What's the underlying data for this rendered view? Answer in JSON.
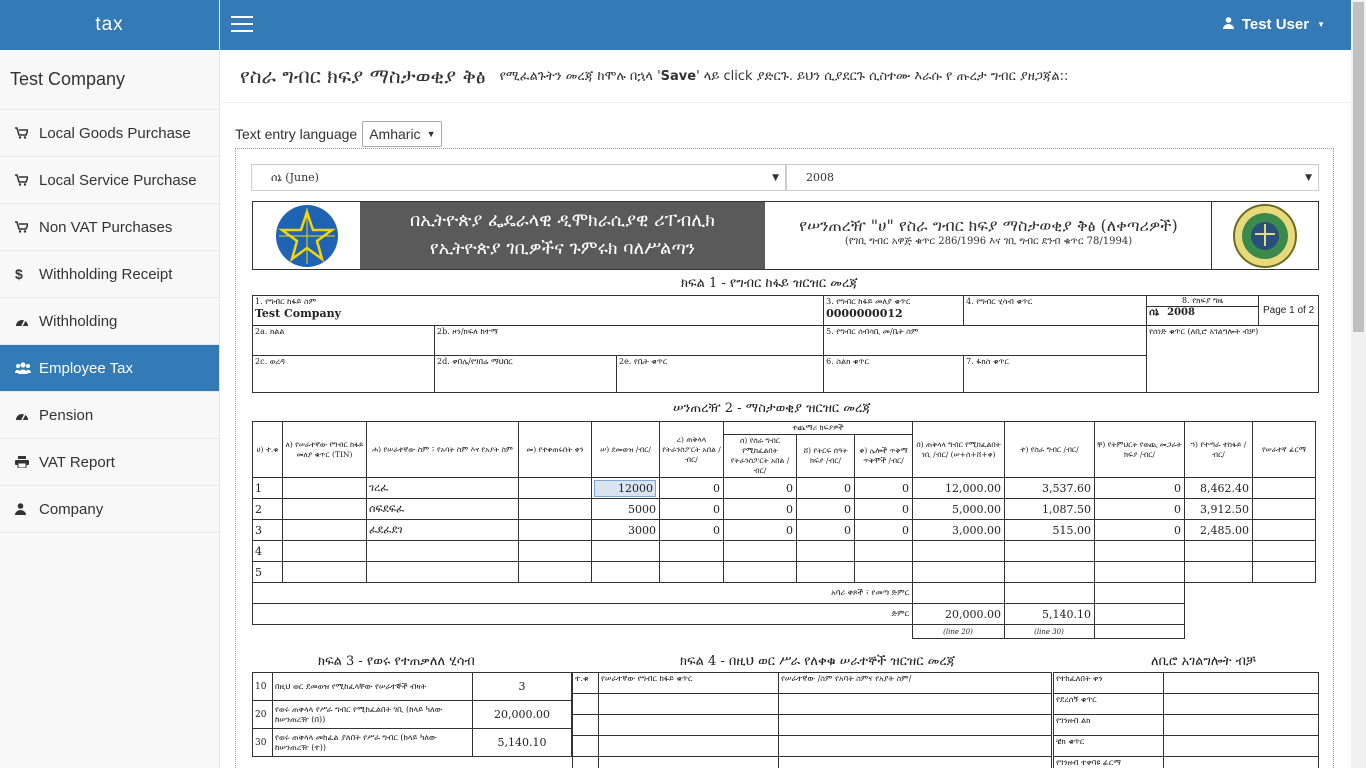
{
  "brand": "tax",
  "company_name": "Test Company",
  "user": {
    "name": "Test User"
  },
  "sidebar": {
    "items": [
      {
        "label": "Local Goods Purchase",
        "icon": "cart-icon"
      },
      {
        "label": "Local Service Purchase",
        "icon": "cart-icon"
      },
      {
        "label": "Non VAT Purchases",
        "icon": "cart-icon"
      },
      {
        "label": "Withholding Receipt",
        "icon": "dollar-icon"
      },
      {
        "label": "Withholding",
        "icon": "dashboard-icon"
      },
      {
        "label": "Employee Tax",
        "icon": "users-icon",
        "active": true
      },
      {
        "label": "Pension",
        "icon": "dashboard-icon"
      },
      {
        "label": "VAT Report",
        "icon": "print-icon"
      },
      {
        "label": "Company",
        "icon": "user-icon"
      }
    ]
  },
  "page": {
    "title": "የስራ ግብር ክፍያ ማስታወቂያ ቅፅ",
    "hint_pre": "የሚፈልጉትን መረጃ ከሞሉ በኋላ '",
    "hint_bold": "Save",
    "hint_post": "' ላይ click ያድርጉ. ይህን ሲያደርጉ ሲስተሙ እራሱ የ ጡረታ ግብር ያዘጋጃል::"
  },
  "language": {
    "label": "Text entry language",
    "selected": "Amharic"
  },
  "period": {
    "month": "ሰኔ (June)",
    "year": "2008"
  },
  "form_header": {
    "agency_line1": "በኢትዮጵያ ፌዴራላዊ ዲሞክራሲያዊ ሪፐብሊክ",
    "agency_line2": "የኢትዮጵያ ገቢዎችና ጉምሩክ ባለሥልጣን",
    "form_title": "የሠንጠረዥ \"ሀ\" የስራ ግብር ክፍያ ማስታወቂያ ቅፅ (ለቀጣሪዎች)",
    "form_subtitle": "(የገቢ ግብር አዋጅ ቁጥር 286/1996 እና ገቢ ግብር ደንብ ቁጥር 78/1994)"
  },
  "section1": {
    "title": "ክፍል 1 - የግብር ከፋይ ዝርዝር መረጃ",
    "f1_label": "1. የግብር ከፋይ ስም",
    "f1_value": "Test Company",
    "f3_label": "3. የግብር ከፋይ መለያ ቁጥር",
    "f3_value": "0000000012",
    "f4_label": "4. የግብር ሂሳብ ቁጥር",
    "f8_label": "8. የክፍያ ግዜ",
    "f8_month": "ሰኔ",
    "f8_year": "2008",
    "page_label": "Page 1 of 2",
    "f2a_label": "2a. ክልል",
    "f2b_label": "2b. ዞን/ክፍለ ከተማ",
    "f5_label": "5. የግብር ሰብሳቢ መ/ቤት ስም",
    "doc_label": "የሰነድ ቁጥር (ለቢሮ አገልግሎት ብቻ)",
    "f2c_label": "2c. ወረዳ",
    "f2d_label": "2d. ቀበሌ/የገበሬ ማህበር",
    "f2e_label": "2e. የቤት ቁጥር",
    "f6_label": "6. ስልክ ቁጥር",
    "f7_label": "7. ፋክስ ቁጥር"
  },
  "section2": {
    "title": "ሠንጠረዥ 2 - ማስታወቂያ ዝርዝር መረጃ",
    "group_header": "ተጨማሪ ክፍያዎች",
    "headers": [
      "ሀ) ተ.ቁ",
      "ለ) የሠራተኛው የግብር ከፋይ መለያ ቁጥር (TIN)",
      "ሐ) የሠራተኛው ስም ፣ የአባት ስም እና የአያት ስም",
      "መ) የተቀጠሩበት ቀን",
      "ሠ) ደመወዝ /ብር/",
      "ረ) ጠቅላላ የትራንስፖርት አበል /ብር/",
      "ሰ) የስራ ግብር የሚከፈልበት የትራንስፖርት አበል /ብር/",
      "ሸ) የትርፍ ሰዓት ክፍያ /ብር/",
      "ቀ) ሌሎች ጥቅማ ጥቅሞች /ብር/",
      "በ) ጠቅላላ ግብር የሚከፈልበት ገቢ /ብር/ (ሠ+ሰ+ሸ+ቀ)",
      "ተ) የስራ ግብር /ብር/",
      "ቸ) የትምህርት የወጪ መጋራት ክፍያ /ብር/",
      "ኀ) የተጣራ ተከፋይ /ብር/",
      "የሠራተኛ ፊርማ"
    ],
    "rows": [
      {
        "no": "1",
        "tin": "",
        "name": "ገረፈ",
        "date": "",
        "salary": "12000",
        "transport": "0",
        "taxable_transport": "0",
        "overtime": "0",
        "other": "0",
        "taxable_income": "12,000.00",
        "tax": "3,537.60",
        "cost_sharing": "0",
        "net": "8,462.40"
      },
      {
        "no": "2",
        "tin": "",
        "name": "ሰፍደፍፈ",
        "date": "",
        "salary": "5000",
        "transport": "0",
        "taxable_transport": "0",
        "overtime": "0",
        "other": "0",
        "taxable_income": "5,000.00",
        "tax": "1,087.50",
        "cost_sharing": "0",
        "net": "3,912.50"
      },
      {
        "no": "3",
        "tin": "",
        "name": "ፈደፈደገ",
        "date": "",
        "salary": "3000",
        "transport": "0",
        "taxable_transport": "0",
        "overtime": "0",
        "other": "0",
        "taxable_income": "3,000.00",
        "tax": "515.00",
        "cost_sharing": "0",
        "net": "2,485.00"
      },
      {
        "no": "4",
        "tin": "",
        "name": "",
        "date": "",
        "salary": "",
        "transport": "",
        "taxable_transport": "",
        "overtime": "",
        "other": "",
        "taxable_income": "",
        "tax": "",
        "cost_sharing": "",
        "net": ""
      },
      {
        "no": "5",
        "tin": "",
        "name": "",
        "date": "",
        "salary": "",
        "transport": "",
        "taxable_transport": "",
        "overtime": "",
        "other": "",
        "taxable_income": "",
        "tax": "",
        "cost_sharing": "",
        "net": ""
      }
    ],
    "page_total_label": "አባሪ ቅጾች ፣ የመጣ ድምር",
    "total_label": "ድምር",
    "total_income": "20,000.00",
    "total_tax": "5,140.10",
    "line20": "(line 20)",
    "line30": "(line 30)"
  },
  "section3": {
    "title": "ክፍል 3 - የወሩ የተጠቃለለ ሂሳብ",
    "rows": [
      {
        "line": "10",
        "label": "በዚህ ወር ደመወዝ የሚከፈላቸው የሠራተኞች ብዛት",
        "value": "3"
      },
      {
        "line": "20",
        "label": "የወሩ ጠቅላላ የሥራ ግብር የሚከፈልበት ገቢ (ከላይ ካለው ከሠንጠረዥ (በ))",
        "value": "20,000.00"
      },
      {
        "line": "30",
        "label": "የወሩ ጠቅላላ መከፈል ያለበት የሥራ ግብር (ከላይ ካለው ከሠንጠረዥ (ተ))",
        "value": "5,140.10"
      }
    ]
  },
  "section4": {
    "title": "ክፍል 4 - በዚህ ወር ሥራ የለቀቁ ሠራተኞች ዝርዝር መረጃ",
    "col_no": "ተ.ቁ",
    "col_tin": "የሠራተኛው የግብር ከፋይ ቁጥር",
    "col_name": "የሠራተኛው /ስም የአባት ስምና የአያት ስም/"
  },
  "office": {
    "title": "ለቢሮ አገልግሎት ብቻ",
    "rows": [
      "የተከፈለበት ቀን",
      "የደረሰኝ ቁጥር",
      "የገንዘብ ልክ",
      "ቼክ ቁጥር",
      "የገንዘብ ተቀባዩ ፊርማ"
    ]
  }
}
